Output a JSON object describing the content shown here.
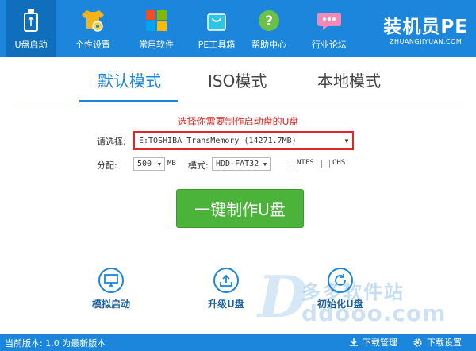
{
  "nav": {
    "items": [
      {
        "label": "U盘启动",
        "icon": "usb-drive-icon",
        "active": true
      },
      {
        "label": "个性设置",
        "icon": "shirt-gear-icon"
      },
      {
        "label": "常用软件",
        "icon": "windows-tiles-icon"
      },
      {
        "label": "PE工具箱",
        "icon": "shopping-bag-icon"
      },
      {
        "label": "帮助中心",
        "icon": "question-icon"
      },
      {
        "label": "行业论坛",
        "icon": "chat-bubble-icon"
      }
    ],
    "brand_title": "装机员PE",
    "brand_url": "ZHUANGJIYUAN.COM"
  },
  "tabs": [
    "默认模式",
    "ISO模式",
    "本地模式"
  ],
  "hint": "选择你需要制作启动盘的U盘",
  "form": {
    "select_label": "请选择:",
    "disk_value": "E:TOSHIBA TransMemory (14271.7MB)",
    "alloc_label": "分配:",
    "alloc_value": "500",
    "alloc_unit": "MB",
    "mode_label": "模式:",
    "mode_value": "HDD-FAT32",
    "ntfs_label": "NTFS",
    "chs_label": "CHS"
  },
  "make_button": "一键制作U盘",
  "actions": [
    {
      "label": "模拟启动",
      "icon": "monitor-icon"
    },
    {
      "label": "升级U盘",
      "icon": "upgrade-icon"
    },
    {
      "label": "初始化U盘",
      "icon": "reset-icon"
    }
  ],
  "watermark": {
    "cn": "多多软件站",
    "en": "ddooo.com"
  },
  "status": {
    "version": "当前版本: 1.0 为最新版本",
    "download_mgr": "下载管理",
    "download_settings": "下载设置"
  },
  "colors": {
    "primary": "#1b86db",
    "button_green": "#4bb23a",
    "hint_red": "#e02424"
  }
}
